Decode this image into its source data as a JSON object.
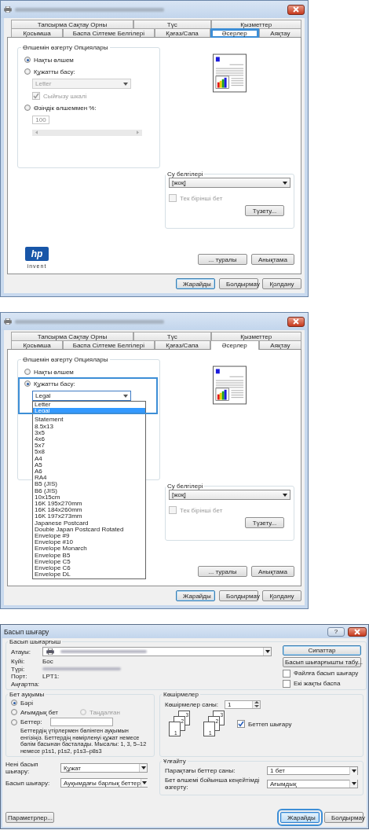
{
  "property_dialogs": [
    {
      "tab_rows": [
        [
          {
            "label": "Тапсырма Сақтау Орны",
            "selected": false
          },
          {
            "label": "Түс",
            "selected": false
          },
          {
            "label": "Қызметтер",
            "selected": false
          }
        ],
        [
          {
            "label": "Қосымша",
            "selected": false
          },
          {
            "label": "Баспа Сілтеме Белгілері",
            "selected": false
          },
          {
            "label": "Қағаз/Сапа",
            "selected": false
          },
          {
            "label": "Әсерлер",
            "selected": true,
            "callout": true
          },
          {
            "label": "Аяқтау",
            "selected": false
          }
        ]
      ],
      "resize": {
        "title": "Өлшемін өзгерту Опциялары",
        "items": [
          {
            "kind": "radio",
            "label": "Нақты өлшем",
            "checked": true
          },
          {
            "kind": "radio",
            "label": "Құжатты басу:",
            "checked": false
          },
          {
            "kind": "select",
            "value": "Letter",
            "disabled": true
          },
          {
            "kind": "checkbox",
            "label": "Сыйғызу шкалі",
            "checked": true,
            "disabled": true
          },
          {
            "kind": "radio",
            "label": "Өзіндік өлшеммен %:",
            "checked": false
          },
          {
            "kind": "number",
            "value": "100",
            "disabled": true
          },
          {
            "kind": "slider",
            "disabled": true
          }
        ]
      },
      "watermarks": {
        "title": "Су белгілері",
        "value": "[жоқ]",
        "first_page_only": {
          "label": "Тек бірінші бет",
          "checked": false,
          "disabled": true
        },
        "edit_button": "Түзету..."
      },
      "logo": {
        "mark": "hp",
        "tagline": "invent"
      },
      "side_buttons": [
        "... туралы",
        "Анықтама"
      ],
      "buttons": [
        {
          "label": "Жарайды",
          "default": true
        },
        {
          "label": "Болдырмау",
          "default": false
        },
        {
          "label": "Қолдану",
          "default": false
        }
      ]
    },
    {
      "tab_rows": [
        [
          {
            "label": "Тапсырма Сақтау Орны",
            "selected": false
          },
          {
            "label": "Түс",
            "selected": false
          },
          {
            "label": "Қызметтер",
            "selected": false
          }
        ],
        [
          {
            "label": "Қосымша",
            "selected": false
          },
          {
            "label": "Баспа Сілтеме Белгілері",
            "selected": false
          },
          {
            "label": "Қағаз/Сапа",
            "selected": false
          },
          {
            "label": "Әсерлер",
            "selected": true
          },
          {
            "label": "Аяқтау",
            "selected": false
          }
        ]
      ],
      "resize": {
        "title": "Өлшемін өзгерту Опциялары",
        "items": [
          {
            "kind": "radio",
            "label": "Нақты өлшем",
            "checked": false
          },
          {
            "kind": "radio",
            "label": "Құжатты басу:",
            "checked": true,
            "callout": true
          },
          {
            "kind": "select",
            "value": "Legal",
            "disabled": false,
            "callout": true,
            "open": true,
            "options": [
              {
                "label": "Letter",
                "selected": false
              },
              {
                "label": "Legal",
                "selected": true
              },
              {
                "label": "Statement",
                "selected": false
              },
              {
                "label": "8.5x13",
                "selected": false
              },
              {
                "label": "3x5",
                "selected": false
              },
              {
                "label": "4x6",
                "selected": false
              },
              {
                "label": "5x7",
                "selected": false
              },
              {
                "label": "5x8",
                "selected": false
              },
              {
                "label": "A4",
                "selected": false
              },
              {
                "label": "A5",
                "selected": false
              },
              {
                "label": "A6",
                "selected": false
              },
              {
                "label": "RA4",
                "selected": false
              },
              {
                "label": "B5 (JIS)",
                "selected": false
              },
              {
                "label": "B6 (JIS)",
                "selected": false
              },
              {
                "label": "10x15cm",
                "selected": false
              },
              {
                "label": "16K 195x270mm",
                "selected": false
              },
              {
                "label": "16K 184x260mm",
                "selected": false
              },
              {
                "label": "16K 197x273mm",
                "selected": false
              },
              {
                "label": "Japanese Postcard",
                "selected": false
              },
              {
                "label": "Double Japan Postcard Rotated",
                "selected": false
              },
              {
                "label": "Envelope #9",
                "selected": false
              },
              {
                "label": "Envelope #10",
                "selected": false
              },
              {
                "label": "Envelope Monarch",
                "selected": false
              },
              {
                "label": "Envelope B5",
                "selected": false
              },
              {
                "label": "Envelope C5",
                "selected": false
              },
              {
                "label": "Envelope C6",
                "selected": false
              },
              {
                "label": "Envelope DL",
                "selected": false
              }
            ]
          }
        ]
      },
      "watermarks": {
        "title": "Су белгілері",
        "value": "[жоқ]",
        "first_page_only": {
          "label": "Тек бірінші бет",
          "checked": false,
          "disabled": true
        },
        "edit_button": "Түзету..."
      },
      "side_buttons": [
        "... туралы",
        "Анықтама"
      ],
      "buttons": [
        {
          "label": "Жарайды",
          "default": true
        },
        {
          "label": "Болдырмау",
          "default": false
        },
        {
          "label": "Қолдану",
          "default": false
        }
      ]
    }
  ],
  "print_dialog": {
    "title": "Басып шығару",
    "help_button": "?",
    "printer": {
      "title": "Басып шығарғыш",
      "name_label": "Атауы:",
      "fields": [
        {
          "label": "Күйі:",
          "value": "Бос"
        },
        {
          "label": "Түрі:",
          "redacted": true
        },
        {
          "label": "Порт:",
          "value": "LPT1:"
        },
        {
          "label": "Аңғартпа:"
        }
      ],
      "buttons": [
        {
          "label": "Сипаттар",
          "default": true
        },
        {
          "label": "Басып шығарғышты табу...",
          "default": false
        }
      ],
      "checks": [
        {
          "label": "Файлға басып шығару",
          "checked": false
        },
        {
          "label": "Екі жақты баспа",
          "checked": false
        }
      ]
    },
    "range": {
      "title": "Бет ауқымы",
      "options": [
        {
          "label": "Бәрі",
          "checked": true,
          "disabled": false
        },
        {
          "label": "Ағымдық бет",
          "checked": false,
          "disabled": false
        },
        {
          "label": "Таңдалған",
          "checked": false,
          "disabled": true
        },
        {
          "label": "Беттер:",
          "checked": false,
          "disabled": false
        }
      ],
      "hint": "Беттердің үтірлермен бөлінген ауқымын енгізіңіз. Беттердің нөмірленуі құжат немесе бөлім басынан басталады. Мысалы: 1, 3, 5–12 немесе p1s1, p1s2, p1s3–p8s3"
    },
    "copies": {
      "title": "Көшірмелер",
      "count_label": "Көшірмелер саны:",
      "count": "1",
      "stacks": [
        [
          "1",
          "2",
          "3"
        ],
        [
          "1",
          "2",
          "3"
        ]
      ],
      "collate": {
        "label": "Беттеп шығару",
        "checked": true
      }
    },
    "what": {
      "label": "Нені басып шығару:",
      "value": "Құжат"
    },
    "print": {
      "label": "Басып шығару:",
      "value": "Ауқымдағы барлық беттер"
    },
    "zoom": {
      "title": "Ұлғайту",
      "rows": [
        {
          "label": "Парақтағы беттер саны:",
          "value": "1 бет"
        },
        {
          "label": "Бет өлшемі бойынша кеңейтімді өзгерту:",
          "value": "Ағымдық"
        }
      ]
    },
    "options_button": "Параметрлер...",
    "buttons": [
      {
        "label": "Жарайды",
        "default": true,
        "callout": true
      },
      {
        "label": "Болдырмау",
        "default": false,
        "callout": false
      }
    ]
  }
}
